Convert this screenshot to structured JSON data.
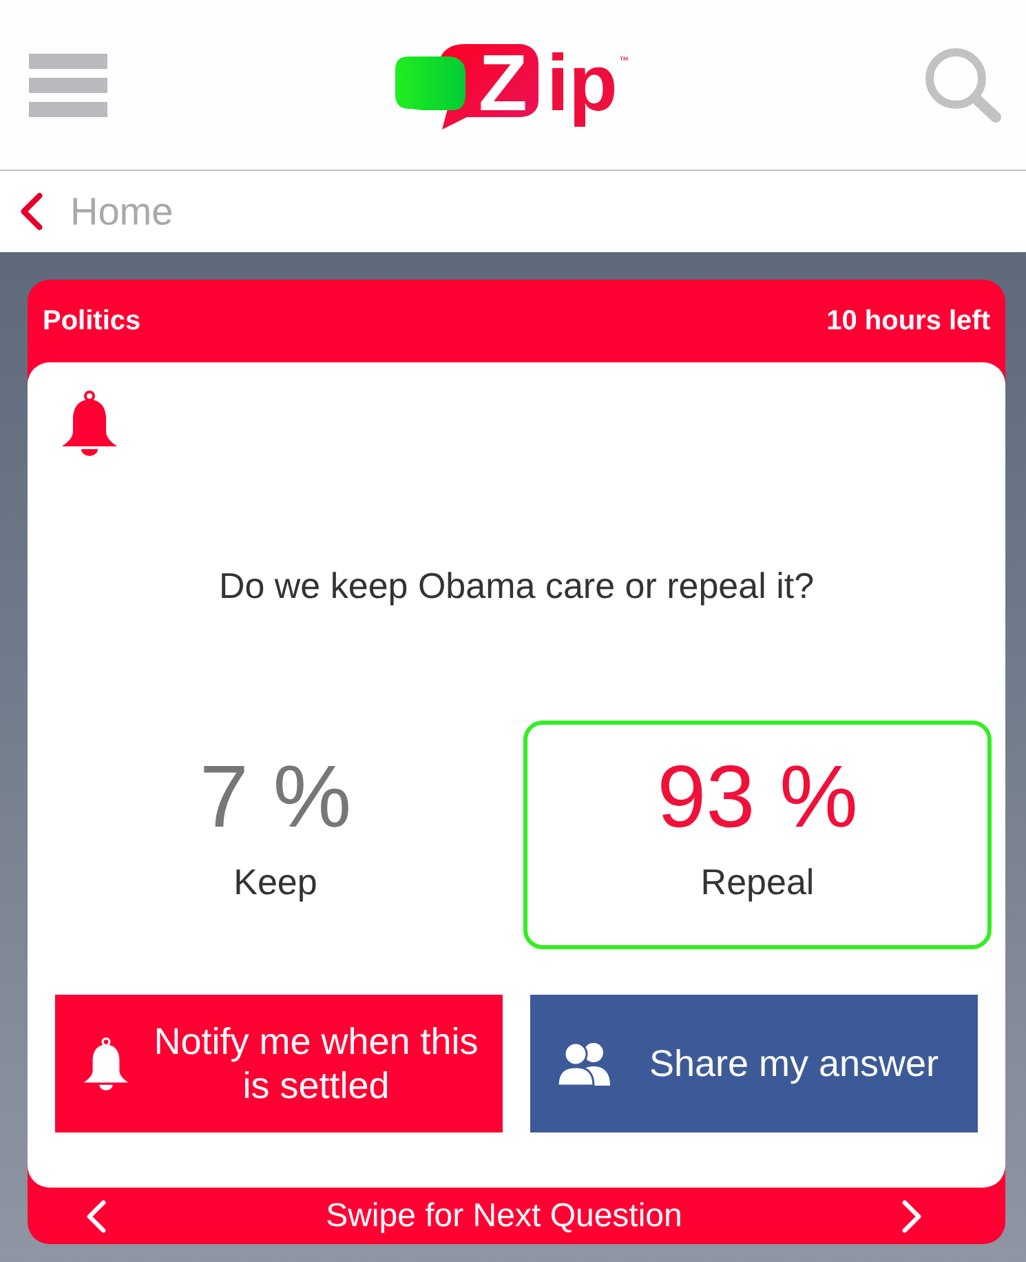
{
  "header": {
    "logo": {
      "text": "Zip",
      "trademark": "™"
    }
  },
  "breadcrumb": {
    "label": "Home"
  },
  "card": {
    "category": "Politics",
    "time_left": "10 hours left",
    "question": "Do we keep Obama care or repeal it?",
    "options": [
      {
        "percent": "7 %",
        "label": "Keep",
        "selected": false
      },
      {
        "percent": "93 %",
        "label": "Repeal",
        "selected": true
      }
    ],
    "actions": [
      {
        "kind": "notify",
        "label": "Notify me when this is settled"
      },
      {
        "kind": "share",
        "label": "Share my answer"
      }
    ],
    "footer": {
      "label": "Swipe for Next Question"
    }
  }
}
